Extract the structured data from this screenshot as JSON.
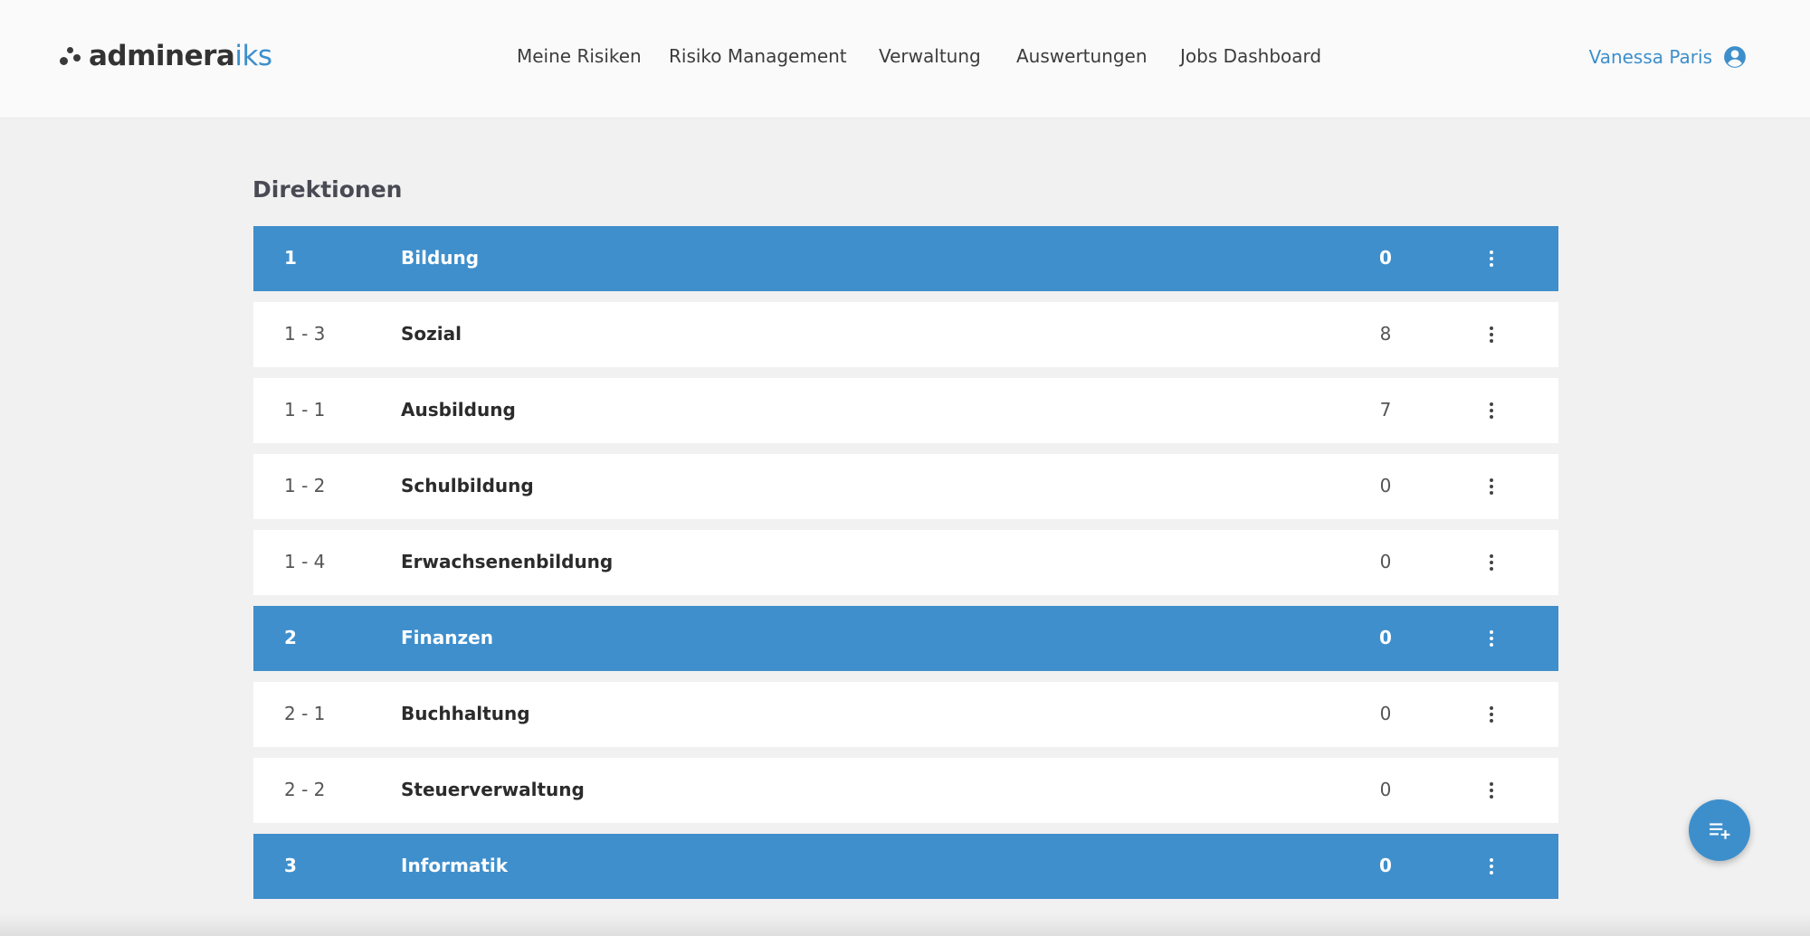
{
  "brand": {
    "name": "adminera",
    "suffix": "iks"
  },
  "nav": {
    "items": [
      {
        "label": "Meine Risiken"
      },
      {
        "label": "Risiko Management"
      },
      {
        "label": "Verwaltung"
      },
      {
        "label": "Auswertungen"
      },
      {
        "label": "Jobs Dashboard"
      }
    ]
  },
  "user": {
    "name": "Vanessa Paris",
    "icon": "account-circle-icon"
  },
  "page": {
    "title": "Direktionen"
  },
  "rows": [
    {
      "type": "group",
      "num": "1",
      "name": "Bildung",
      "count": "0"
    },
    {
      "type": "item",
      "num": "1 - 3",
      "name": "Sozial",
      "count": "8"
    },
    {
      "type": "item",
      "num": "1 - 1",
      "name": "Ausbildung",
      "count": "7"
    },
    {
      "type": "item",
      "num": "1 - 2",
      "name": "Schulbildung",
      "count": "0"
    },
    {
      "type": "item",
      "num": "1 - 4",
      "name": "Erwachsenenbildung",
      "count": "0"
    },
    {
      "type": "group",
      "num": "2",
      "name": "Finanzen",
      "count": "0"
    },
    {
      "type": "item",
      "num": "2 - 1",
      "name": "Buchhaltung",
      "count": "0"
    },
    {
      "type": "item",
      "num": "2 - 2",
      "name": "Steuerverwaltung",
      "count": "0"
    },
    {
      "type": "group",
      "num": "3",
      "name": "Informatik",
      "count": "0"
    }
  ],
  "fab": {
    "icon": "playlist-add-icon"
  },
  "colors": {
    "accent": "#3f8fcc",
    "background": "#f1f1f1",
    "header": "#fafafa"
  }
}
